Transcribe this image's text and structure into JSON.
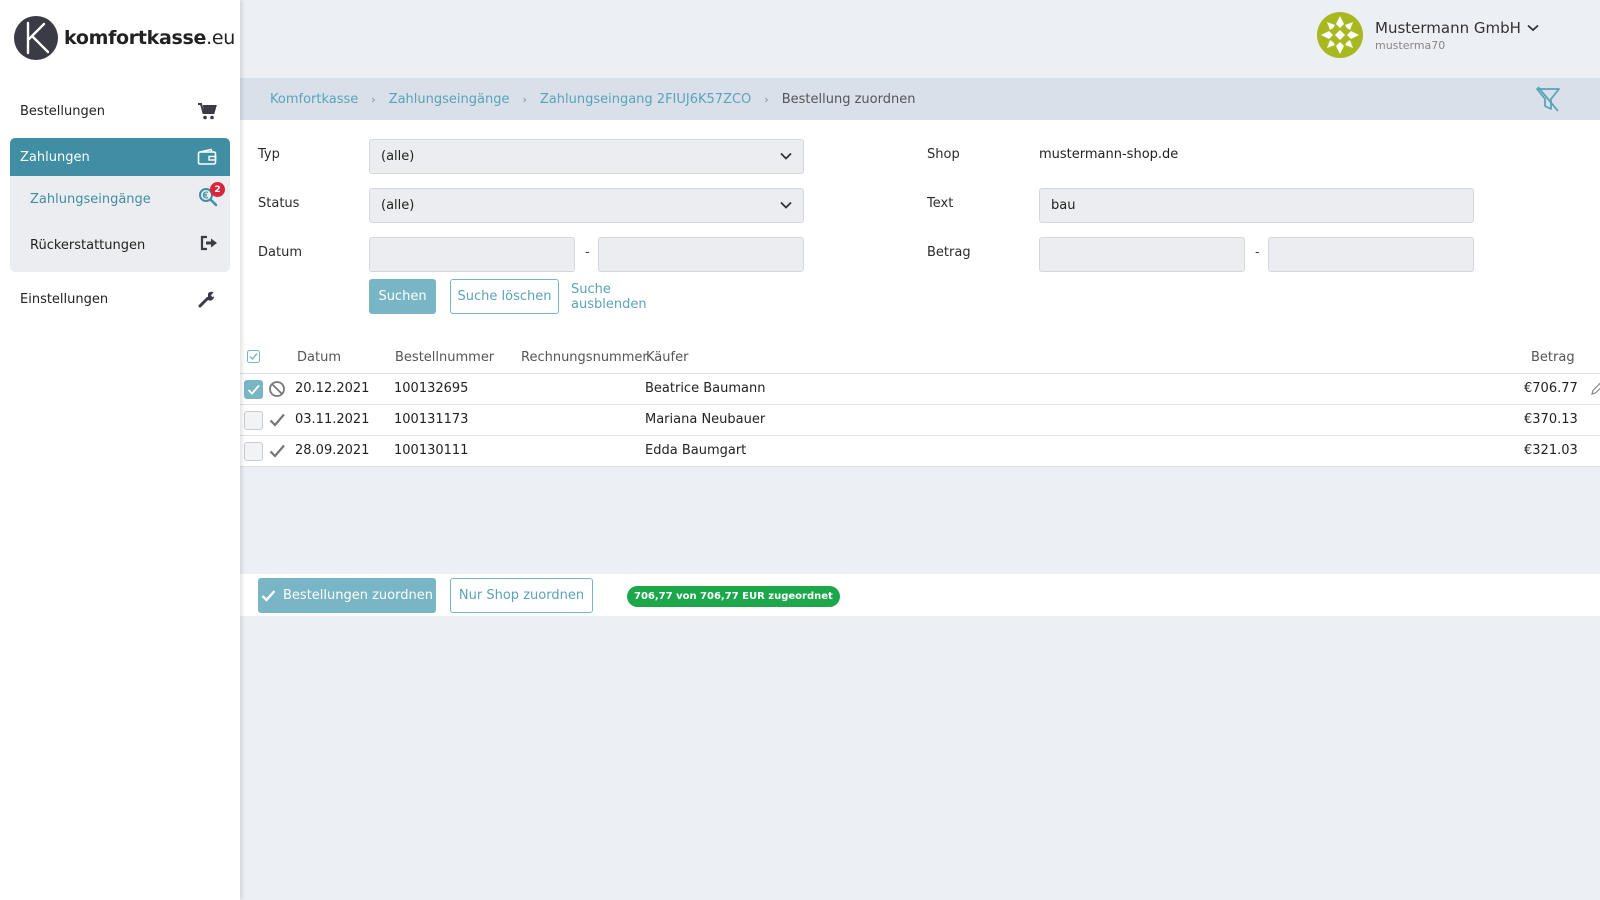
{
  "brand": {
    "logo_text_bold": "komfortkasse",
    "logo_text_rest": ".eu"
  },
  "sidebar": {
    "items": [
      {
        "label": "Bestellungen",
        "icon": "cart-icon"
      },
      {
        "label": "Zahlungen",
        "icon": "wallet-icon"
      },
      {
        "label": "Zahlungseingänge",
        "icon": "search-euro-icon",
        "badge": "2"
      },
      {
        "label": "Rückerstattungen",
        "icon": "exit-icon"
      },
      {
        "label": "Einstellungen",
        "icon": "wrench-icon"
      }
    ]
  },
  "header": {
    "company": "Mustermann GmbH",
    "user_id": "musterma70"
  },
  "breadcrumb": [
    "Komfortkasse",
    "Zahlungseingänge",
    "Zahlungseingang 2FIUJ6K57ZCO",
    "Bestellung zuordnen"
  ],
  "search": {
    "typ_label": "Typ",
    "typ_value": "(alle)",
    "status_label": "Status",
    "status_value": "(alle)",
    "datum_label": "Datum",
    "datum_from": "",
    "datum_to": "",
    "range_sep": "-",
    "shop_label": "Shop",
    "shop_value": "mustermann-shop.de",
    "text_label": "Text",
    "text_value": "bau",
    "betrag_label": "Betrag",
    "betrag_from": "",
    "betrag_to": "",
    "btn_search": "Suchen",
    "btn_clear": "Suche löschen",
    "btn_hide": "Suche ausblenden"
  },
  "table": {
    "headers": {
      "datum": "Datum",
      "bestellnummer": "Bestellnummer",
      "rechnungsnummer": "Rechnungsnummer",
      "kaeufer": "Käufer",
      "betrag": "Betrag"
    },
    "rows": [
      {
        "checked": true,
        "state": "ban-icon",
        "datum": "20.12.2021",
        "bestellnummer": "100132695",
        "rechnungsnummer": "",
        "kaeufer": "Beatrice Baumann",
        "betrag": "€706.77"
      },
      {
        "checked": false,
        "state": "check-icon",
        "datum": "03.11.2021",
        "bestellnummer": "100131173",
        "rechnungsnummer": "",
        "kaeufer": "Mariana Neubauer",
        "betrag": "€370.13"
      },
      {
        "checked": false,
        "state": "check-icon",
        "datum": "28.09.2021",
        "bestellnummer": "100130111",
        "rechnungsnummer": "",
        "kaeufer": "Edda Baumgart",
        "betrag": "€321.03"
      }
    ]
  },
  "actions": {
    "assign_orders": "Bestellungen zuordnen",
    "assign_shop": "Nur Shop zuordnen",
    "status": "706,77 von 706,77 EUR zugeordnet"
  },
  "colors": {
    "accent": "#3f8ea3",
    "accent_light": "#78b6c6",
    "success": "#1ca84a",
    "badge": "#d9263b"
  }
}
